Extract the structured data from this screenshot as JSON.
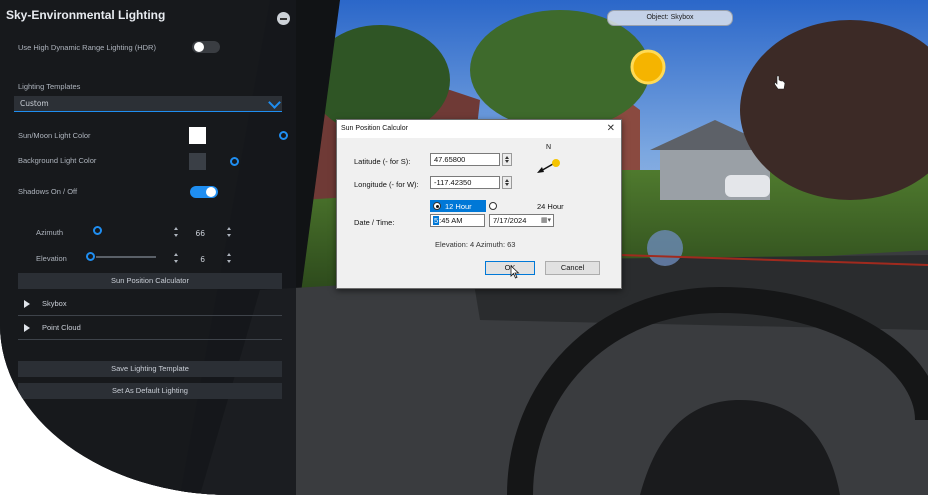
{
  "panel": {
    "title": "Sky-Environmental Lighting",
    "hdr_label": "Use High Dynamic Range Lighting (HDR)",
    "hdr_enabled": false,
    "templates_label": "Lighting Templates",
    "template_selected": "Custom",
    "sun_moon_label": "Sun/Moon Light Color",
    "background_label": "Background Light Color",
    "shadows_label": "Shadows On / Off",
    "shadows_enabled": true,
    "azimuth_label": "Azimuth",
    "azimuth_value": "66",
    "elevation_label": "Elevation",
    "elevation_value": "6",
    "sun_calc_button": "Sun Position Calculator",
    "sections": [
      {
        "label": "Skybox"
      },
      {
        "label": "Point Cloud"
      }
    ],
    "save_button": "Save Lighting Template",
    "default_button": "Set As Default Lighting"
  },
  "object_tag": "Object: Skybox",
  "dialog": {
    "title": "Sun Position Calculor",
    "close_glyph": "✕",
    "north_label": "N",
    "latitude_label": "Latitude (- for S):",
    "latitude_value": "47.65800",
    "longitude_label": "Longitude (- for W):",
    "longitude_value": "-117.42350",
    "datetime_label": "Date / Time:",
    "hour12_label": "12 Hour",
    "hour24_label": "24 Hour",
    "hour12_selected": true,
    "time_hour": "5",
    "time_rest": ":45 AM",
    "date_value": "7/17/2024",
    "result_text": "Elevation: 4  Azimuth: 63",
    "ok_label": "OK",
    "cancel_label": "Cancel"
  },
  "colors": {
    "accent": "#1f8ef1",
    "sun_moon_color": "#ffffff",
    "background_color": "#3a3f46",
    "sun": "#f5b400"
  }
}
